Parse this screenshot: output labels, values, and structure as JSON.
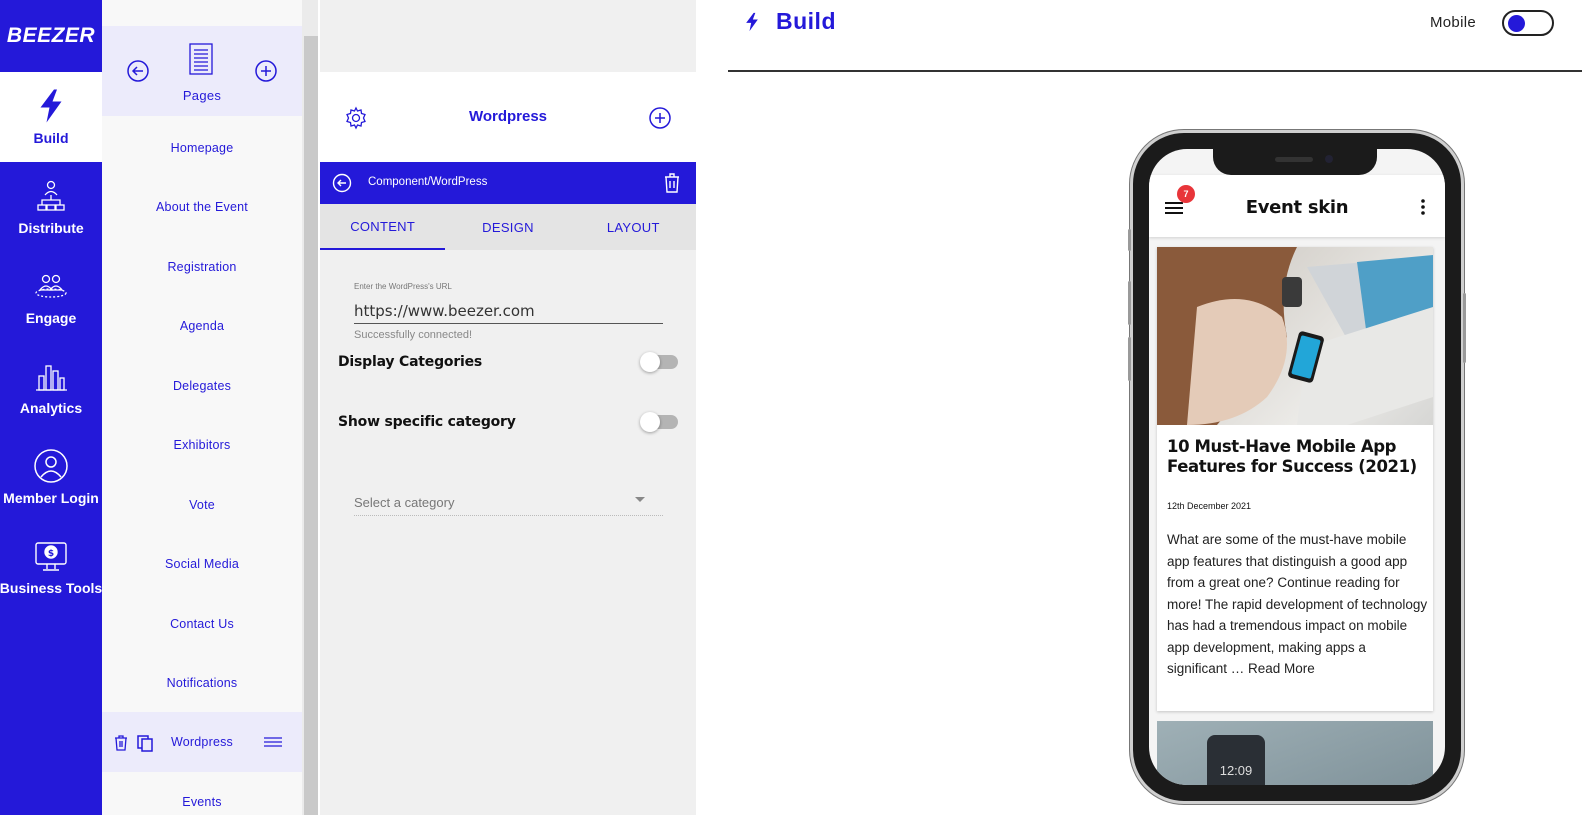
{
  "brand": {
    "logo_text": "BEEZER",
    "accent": "#2419d9"
  },
  "nav": {
    "items": [
      {
        "label": "Build",
        "icon": "lightning-icon",
        "active": true
      },
      {
        "label": "Distribute",
        "icon": "distribute-icon",
        "active": false
      },
      {
        "label": "Engage",
        "icon": "engage-icon",
        "active": false
      },
      {
        "label": "Analytics",
        "icon": "analytics-icon",
        "active": false
      },
      {
        "label": "Member Login",
        "icon": "member-icon",
        "active": false
      },
      {
        "label": "Business Tools",
        "icon": "business-icon",
        "active": false
      }
    ]
  },
  "pages": {
    "title": "Pages",
    "items": [
      "Homepage",
      "About the Event",
      "Registration",
      "Agenda",
      "Delegates",
      "Exhibitors",
      "Vote",
      "Social Media",
      "Contact Us",
      "Notifications",
      "Wordpress",
      "Events"
    ],
    "selected": "Wordpress"
  },
  "panel": {
    "title": "Wordpress",
    "component_path": "Component/WordPress",
    "tabs": [
      "CONTENT",
      "DESIGN",
      "LAYOUT"
    ],
    "active_tab": "CONTENT",
    "url_label": "Enter the WordPress's URL",
    "url_value": "https://www.beezer.com",
    "url_hint": "Successfully connected!",
    "display_categories_label": "Display Categories",
    "show_specific_label": "Show specific category",
    "select_placeholder": "Select a category"
  },
  "preview": {
    "title": "Build",
    "mobile_label": "Mobile",
    "app_title": "Event skin",
    "notification_count": "7",
    "post": {
      "title": "10 Must-Have Mobile App Features for Success (2021)",
      "date": "12th December 2021",
      "excerpt": "What are some of the must-have mobile app features that distinguish a good app from a great one? Continue reading for more! The rapid development of technology has had a tremendous impact on mobile app development, making apps a significant … Read More"
    },
    "next_post_time": "12:09"
  }
}
